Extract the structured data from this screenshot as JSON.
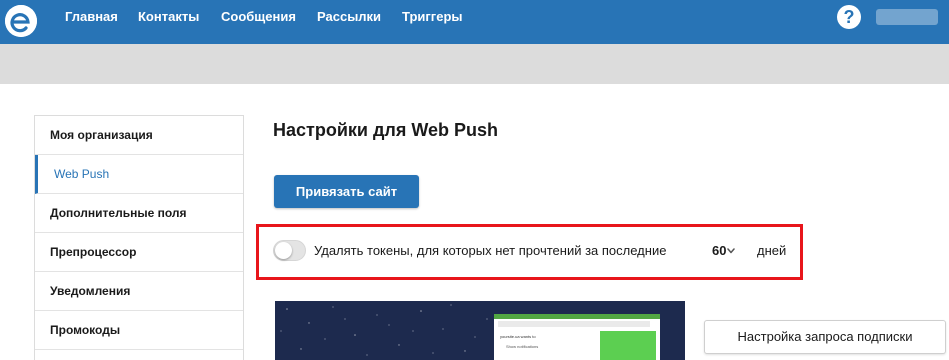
{
  "header": {
    "logo_icon": "brand-e-logo-icon",
    "help_icon": "question-circle-icon",
    "help_glyph": "?",
    "nav": [
      {
        "label": "Главная"
      },
      {
        "label": "Контакты"
      },
      {
        "label": "Сообщения"
      },
      {
        "label": "Рассылки"
      },
      {
        "label": "Триггеры"
      }
    ]
  },
  "sidebar": {
    "items": [
      {
        "label": "Моя организация",
        "active": false
      },
      {
        "label": "Web Push",
        "active": true
      },
      {
        "label": "Дополнительные поля",
        "active": false
      },
      {
        "label": "Препроцессор",
        "active": false
      },
      {
        "label": "Уведомления",
        "active": false
      },
      {
        "label": "Промокоды",
        "active": false
      }
    ]
  },
  "main": {
    "title": "Настройки для Web Push",
    "bind_site_button": "Привязать сайт",
    "token_setting": {
      "enabled": false,
      "label": "Удалять токены, для которых нет прочтений за последние",
      "days_value": "60",
      "days_unit": "дней"
    },
    "preview": {
      "line1": "yoursite.ua wants to",
      "line2": "Show notifications"
    },
    "subscription_button": "Настройка запроса подписки"
  },
  "colors": {
    "accent": "#2874b6",
    "highlight": "#e8151b",
    "preview_bg": "#1d2a4e",
    "preview_green": "#5ccf51"
  }
}
